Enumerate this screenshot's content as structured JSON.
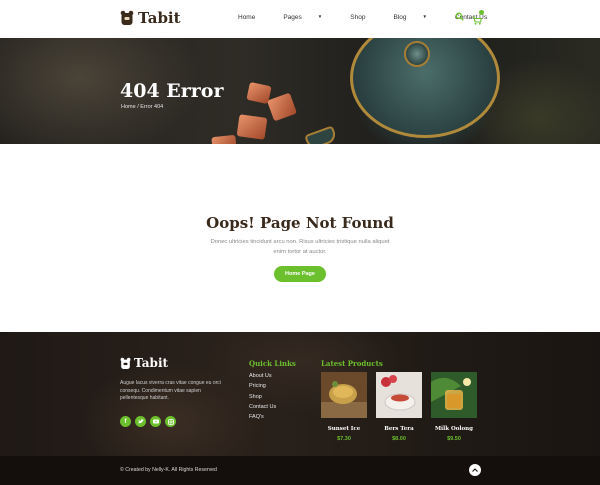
{
  "brand": {
    "name": "Tabit"
  },
  "nav": {
    "items": [
      {
        "label": "Home",
        "dropdown": false
      },
      {
        "label": "Pages",
        "dropdown": true
      },
      {
        "label": "Shop",
        "dropdown": false
      },
      {
        "label": "Blog",
        "dropdown": true
      },
      {
        "label": "Contact Us",
        "dropdown": false
      }
    ],
    "accent_color": "#6cbf2d"
  },
  "hero": {
    "title": "404 Error",
    "breadcrumb": "Home / Error 404"
  },
  "main": {
    "heading": "Oops! Page Not Found",
    "text": "Donec ultricies tincidunt arcu non. Risus ultricies tristique nulla aliquet enim tortor at auctor.",
    "button_label": "Home Page"
  },
  "footer": {
    "brand": "Tabit",
    "about": "Augue lacus viverra cras vitae congue eu orci consequ. Condimentum vitae sapien pellentesque habitant.",
    "socials": [
      "facebook-icon",
      "twitter-icon",
      "youtube-icon",
      "instagram-icon"
    ],
    "quick_links_title": "Quick Links",
    "quick_links": [
      "About Us",
      "Pricing",
      "Shop",
      "Contact Us",
      "FAQ's"
    ],
    "latest_products_title": "Latest Products",
    "products": [
      {
        "name": "Sunset Ice",
        "price": "$7.30"
      },
      {
        "name": "Bers Tera",
        "price": "$8.00"
      },
      {
        "name": "Milk Oolong",
        "price": "$9.50"
      }
    ],
    "copyright": "© Created by Nelly-K. All Rights Reserved"
  }
}
